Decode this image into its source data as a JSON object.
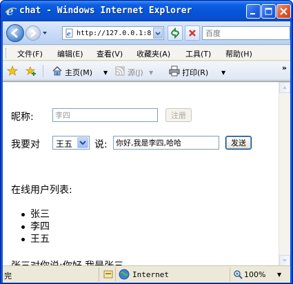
{
  "window": {
    "title": "chat - Windows Internet Explorer"
  },
  "address_bar": {
    "url": "http://127.0.0.1:8",
    "search_placeholder": "百度"
  },
  "menu": [
    {
      "label": "文件(F)"
    },
    {
      "label": "编辑(E)"
    },
    {
      "label": "查看(V)"
    },
    {
      "label": "收藏夹(A)"
    },
    {
      "label": "工具(T)"
    },
    {
      "label": "帮助(H)"
    }
  ],
  "command_bar": {
    "home_label": "主页(M)",
    "feeds_label": "源(J)",
    "print_label": "打印(R)",
    "more": "»"
  },
  "page": {
    "nickname_label": "昵称:",
    "nickname_value": "李四",
    "register_button": "注册",
    "i_want_to": "我要对",
    "selected_user": "王五",
    "say_label": "说:",
    "message_value": "你好,我是李四,哈哈",
    "send_button": "发送",
    "online_list_title": "在线用户列表:",
    "online_users": [
      "张三",
      "李四",
      "王五"
    ],
    "last_message": "张三对你说:你好,我是张三"
  },
  "status_bar": {
    "status_text": "完",
    "zone": "Internet",
    "zoom": "100%"
  },
  "colors": {
    "title_bar": "#0554d9",
    "close_button": "#e0582e",
    "chrome": "#ece9d8"
  }
}
